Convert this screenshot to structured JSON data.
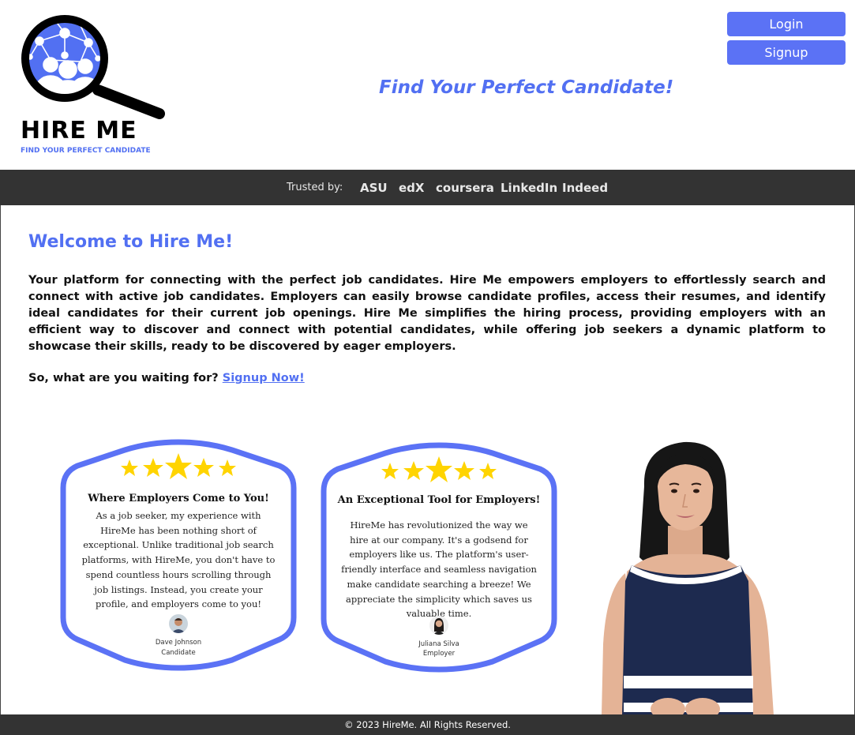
{
  "logo": {
    "title": "HIRE ME",
    "subtitle": "FIND YOUR PERFECT CANDIDATE",
    "icon": "magnifier-network-icon"
  },
  "header": {
    "tagline": "Find Your Perfect Candidate!",
    "login_label": "Login",
    "signup_label": "Signup"
  },
  "trusted": {
    "label": "Trusted by:",
    "partners": [
      "ASU",
      "edX",
      "coursera",
      "LinkedIn",
      "Indeed"
    ]
  },
  "main": {
    "heading": "Welcome to Hire Me!",
    "intro": "Your platform for connecting with the perfect job candidates. Hire Me empowers employers to effortlessly search and connect with active job candidates. Employers can easily browse candidate profiles, access their resumes, and identify ideal candidates for their current job openings. Hire Me simplifies the hiring process, providing employers with an efficient way to discover and connect with potential candidates, while offering job seekers a dynamic platform to showcase their skills, ready to be discovered by eager employers.",
    "cta_text": "So, what are you waiting for?",
    "cta_link": "Signup Now!"
  },
  "reviews": [
    {
      "rating": 5,
      "title": "Where Employers Come to You!",
      "body": "As a job seeker, my experience with HireMe has been nothing short of exceptional. Unlike traditional job search platforms, with HireMe, you don't have to spend countless hours scrolling through job listings. Instead, you create your profile, and employers come to you!",
      "name": "Dave Johnson",
      "role": "Candidate"
    },
    {
      "rating": 5,
      "title": "An Exceptional Tool for Employers!",
      "body": "HireMe has revolutionized the way we hire at our company. It's a godsend for employers like us. The platform's user-friendly interface and seamless navigation make candidate searching a breeze! We appreciate the simplicity which saves us valuable time.",
      "name": "Juliana Silva",
      "role": "Employer"
    }
  ],
  "colors": {
    "brand": "#5270f2",
    "button": "#5b72f5",
    "bar": "#333333",
    "star": "#ffd400"
  },
  "footer": {
    "copyright": "© 2023 HireMe. All Rights Reserved."
  }
}
